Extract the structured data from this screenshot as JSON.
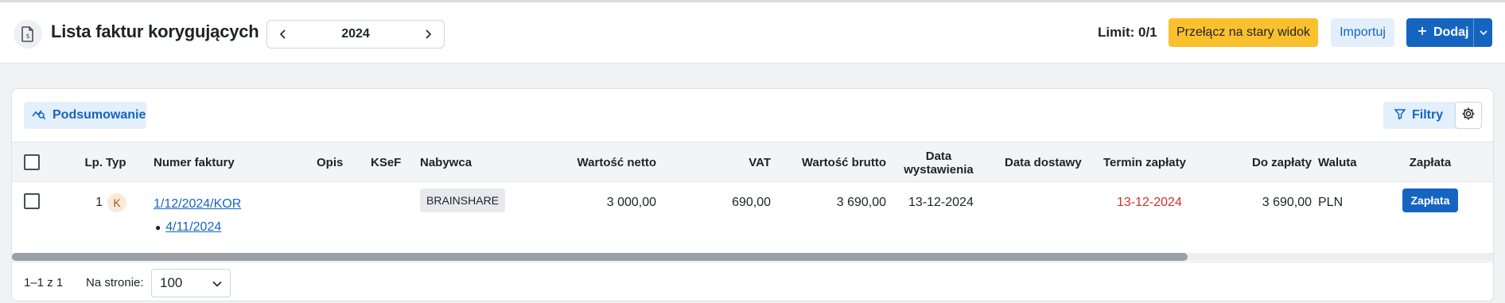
{
  "header": {
    "title": "Lista faktur korygujących",
    "year": "2024",
    "limit": "Limit: 0/1",
    "switch_view_label": "Przełącz na stary widok",
    "import_label": "Importuj",
    "add_label": "Dodaj"
  },
  "toolbar": {
    "summary_label": "Podsumowanie",
    "filters_label": "Filtry"
  },
  "table": {
    "columns": {
      "lp": "Lp.",
      "typ": "Typ",
      "numer": "Numer faktury",
      "opis": "Opis",
      "ksef": "KSeF",
      "nabywca": "Nabywca",
      "netto": "Wartość netto",
      "vat": "VAT",
      "brutto": "Wartość brutto",
      "data_wyst": "Data wystawienia",
      "data_dost": "Data dostawy",
      "termin": "Termin zapłaty",
      "do_zaplaty": "Do zapłaty",
      "waluta": "Waluta",
      "zaplata": "Zapłata"
    },
    "rows": [
      {
        "lp": "1",
        "typ": "K",
        "numer": "1/12/2024/KOR",
        "related": "4/11/2024",
        "opis": "",
        "ksef": "",
        "nabywca": "BRAINSHARE",
        "netto": "3 000,00",
        "vat": "690,00",
        "brutto": "3 690,00",
        "data_wyst": "13-12-2024",
        "data_dost": "",
        "termin": "13-12-2024",
        "do_zaplaty": "3 690,00",
        "waluta": "PLN",
        "zaplata_label": "Zapłata"
      }
    ]
  },
  "footer": {
    "range": "1–1 z 1",
    "per_page_label": "Na stronie:",
    "per_page_value": "100"
  },
  "colors": {
    "primary": "#1565c0",
    "warning": "#fbc02d",
    "overdue": "#d32f2f"
  }
}
